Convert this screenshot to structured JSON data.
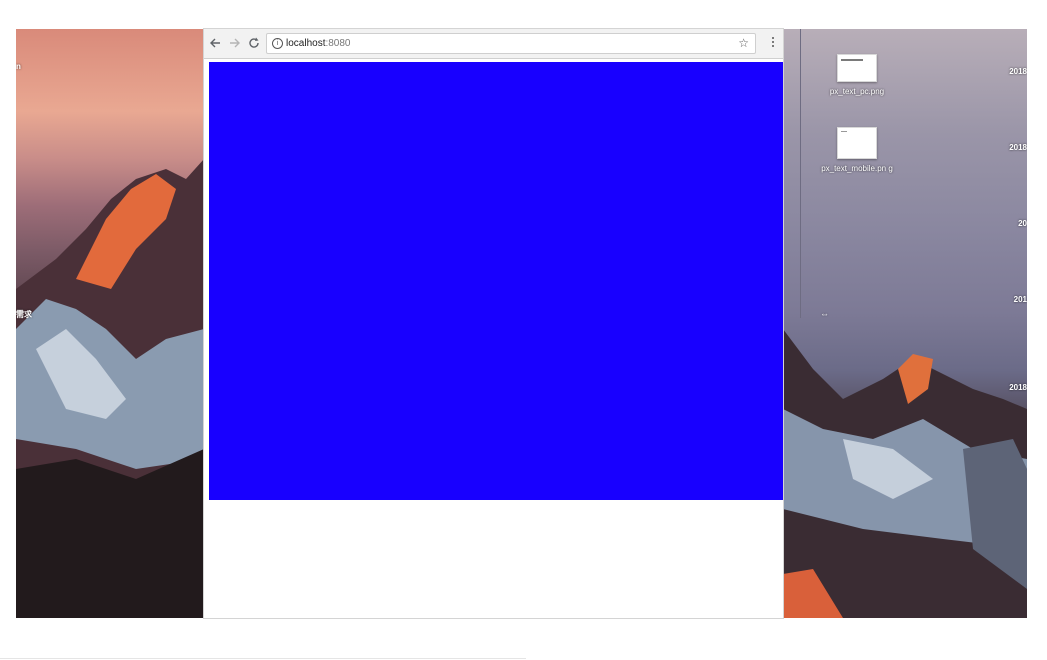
{
  "browser": {
    "url_host": "localhost",
    "url_port": ":8080",
    "back_icon": "arrow-left-icon",
    "forward_icon": "arrow-right-icon",
    "reload_icon": "reload-icon",
    "info_icon": "info-icon",
    "bookmark_icon": "star-icon",
    "menu_icon": "kebab-menu-icon",
    "page_block_color": "#1800ff"
  },
  "desktop": {
    "files": [
      {
        "name": "px_text_pc.png"
      },
      {
        "name": "px_text_mobile.pn g"
      }
    ],
    "left_edge_texts": [
      "n",
      "需求"
    ],
    "right_edge_texts": [
      "2018",
      "2018",
      "20",
      "201",
      "2018"
    ],
    "handle_glyph": "⇔"
  }
}
